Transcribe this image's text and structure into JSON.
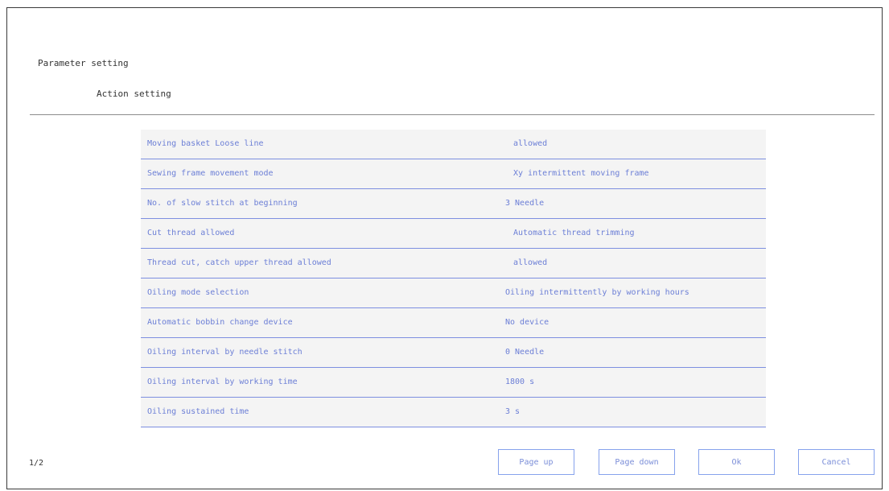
{
  "header": {
    "title": "Parameter setting",
    "subtitle": "Action setting"
  },
  "parameters": [
    {
      "label": "Moving basket Loose line",
      "value": "allowed"
    },
    {
      "label": "Sewing frame movement mode",
      "value": "Xy intermittent moving frame"
    },
    {
      "label": "No. of slow stitch at beginning",
      "value": "3 Needle"
    },
    {
      "label": "Cut thread allowed",
      "value": "Automatic thread trimming"
    },
    {
      "label": "Thread cut, catch upper thread allowed",
      "value": "allowed"
    },
    {
      "label": "Oiling mode selection",
      "value": "Oiling intermittently by working hours"
    },
    {
      "label": "Automatic bobbin change device",
      "value": "No device"
    },
    {
      "label": "Oiling interval by needle stitch",
      "value": "0 Needle"
    },
    {
      "label": "Oiling interval by working time",
      "value": "1800 s"
    },
    {
      "label": "Oiling sustained time",
      "value": "3 s"
    }
  ],
  "footer": {
    "page_indicator": "1/2",
    "page_up_label": "Page up",
    "page_down_label": "Page down",
    "ok_label": "Ok",
    "cancel_label": "Cancel"
  }
}
